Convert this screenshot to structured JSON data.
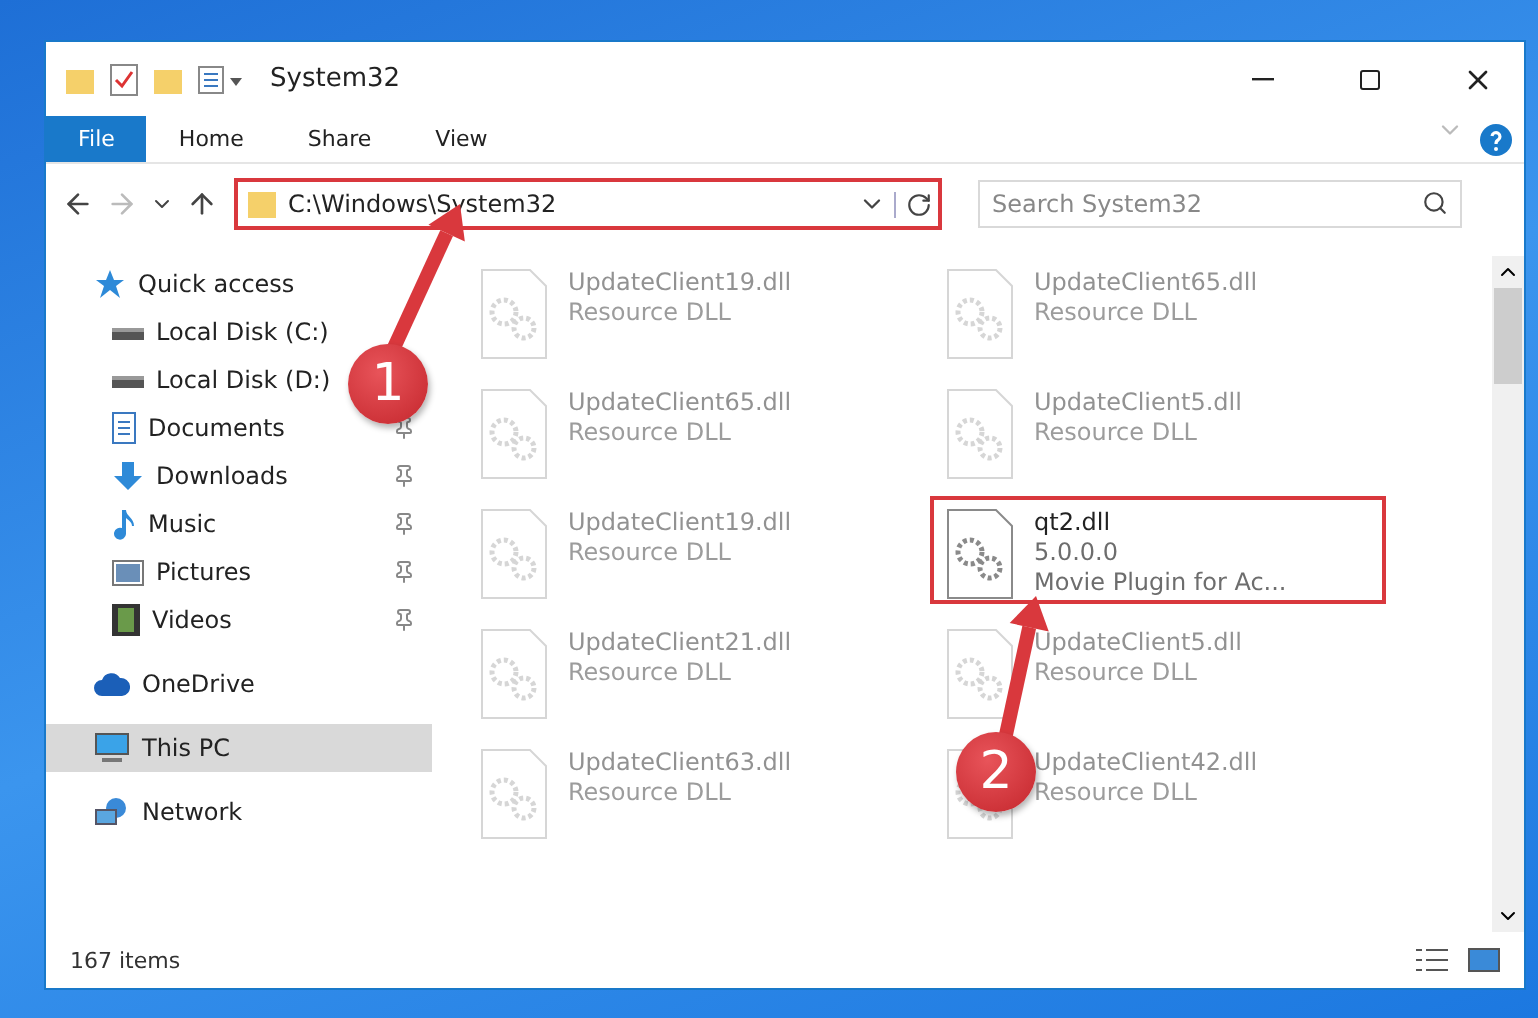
{
  "window": {
    "title": "System32"
  },
  "ribbon": {
    "tabs": [
      {
        "label": "File",
        "selected": true
      },
      {
        "label": "Home",
        "selected": false
      },
      {
        "label": "Share",
        "selected": false
      },
      {
        "label": "View",
        "selected": false
      }
    ]
  },
  "address_bar": {
    "path": "C:\\Windows\\System32",
    "highlighted": true
  },
  "search": {
    "placeholder": "Search System32"
  },
  "sidebar": {
    "items": [
      {
        "label": "Quick access",
        "selected": false,
        "children": [
          {
            "label": "Local Disk (C:)",
            "pinned": false
          },
          {
            "label": "Local Disk (D:)",
            "pinned": false
          },
          {
            "label": "Documents",
            "pinned": true
          },
          {
            "label": "Downloads",
            "pinned": true
          },
          {
            "label": "Music",
            "pinned": true
          },
          {
            "label": "Pictures",
            "pinned": true
          },
          {
            "label": "Videos",
            "pinned": true
          }
        ]
      },
      {
        "label": "OneDrive",
        "selected": false
      },
      {
        "label": "This PC",
        "selected": true
      },
      {
        "label": "Network",
        "selected": false
      }
    ]
  },
  "files": [
    {
      "name": "UpdateClient19.dll",
      "lines": [
        "Resource DLL"
      ],
      "faded": true,
      "highlighted": false
    },
    {
      "name": "UpdateClient65.dll",
      "lines": [
        "Resource DLL"
      ],
      "faded": true,
      "highlighted": false
    },
    {
      "name": "UpdateClient65.dll",
      "lines": [
        "Resource DLL"
      ],
      "faded": true,
      "highlighted": false
    },
    {
      "name": "UpdateClient5.dll",
      "lines": [
        "Resource DLL"
      ],
      "faded": true,
      "highlighted": false
    },
    {
      "name": "UpdateClient19.dll",
      "lines": [
        "Resource DLL"
      ],
      "faded": true,
      "highlighted": false
    },
    {
      "name": "qt2.dll",
      "lines": [
        "5.0.0.0",
        "Movie Plugin for Ac..."
      ],
      "faded": false,
      "highlighted": true
    },
    {
      "name": "UpdateClient21.dll",
      "lines": [
        "Resource DLL"
      ],
      "faded": true,
      "highlighted": false
    },
    {
      "name": "UpdateClient5.dll",
      "lines": [
        "Resource DLL"
      ],
      "faded": true,
      "highlighted": false
    },
    {
      "name": "UpdateClient63.dll",
      "lines": [
        "Resource DLL"
      ],
      "faded": true,
      "highlighted": false
    },
    {
      "name": "UpdateClient42.dll",
      "lines": [
        "Resource DLL"
      ],
      "faded": true,
      "highlighted": false
    }
  ],
  "annotations": [
    {
      "number": "1"
    },
    {
      "number": "2"
    }
  ],
  "status_bar": {
    "count": "167 items"
  }
}
